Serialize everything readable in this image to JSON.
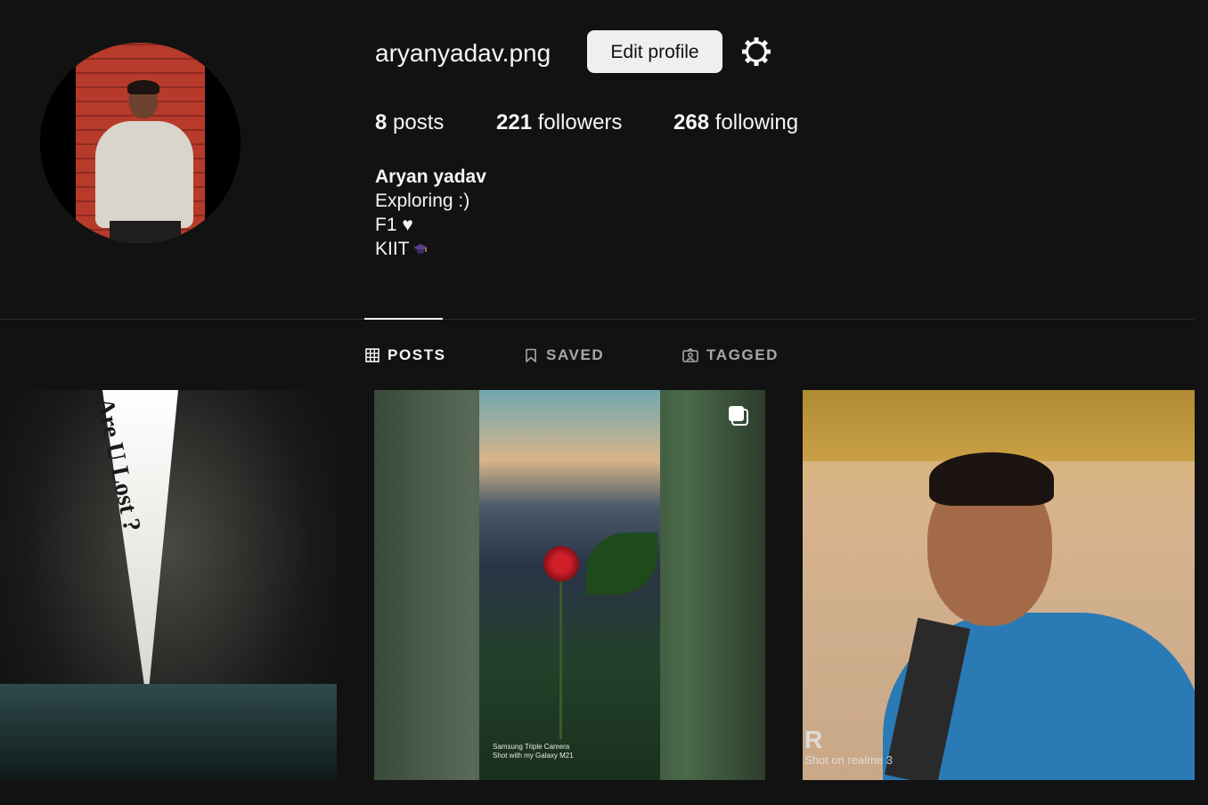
{
  "profile": {
    "username": "aryanyadav.png",
    "edit_label": "Edit profile",
    "stats": {
      "posts_count": "8",
      "posts_label": "posts",
      "followers_count": "221",
      "followers_label": "followers",
      "following_count": "268",
      "following_label": "following"
    },
    "bio": {
      "name": "Aryan yadav",
      "line1": "Exploring :)",
      "line2": "F1 ♥",
      "line3": "KIIT"
    }
  },
  "tabs": [
    {
      "label": "POSTS",
      "icon": "grid-icon",
      "active": true
    },
    {
      "label": "SAVED",
      "icon": "bookmark-icon",
      "active": false
    },
    {
      "label": "TAGGED",
      "icon": "tag-person-icon",
      "active": false
    }
  ],
  "posts": [
    {
      "overlay_text": "Are U Lost ?"
    },
    {
      "watermark_line1": "Samsung Triple Camera",
      "watermark_line2": "Shot with my Galaxy M21",
      "multi_icon": "carousel-icon"
    },
    {
      "watermark_mark": "R",
      "watermark_text": "Shot on realme 3"
    }
  ],
  "colors": {
    "background": "#121212",
    "text": "#f5f5f5",
    "muted": "#a8a8a8",
    "button_bg": "#efefef"
  }
}
